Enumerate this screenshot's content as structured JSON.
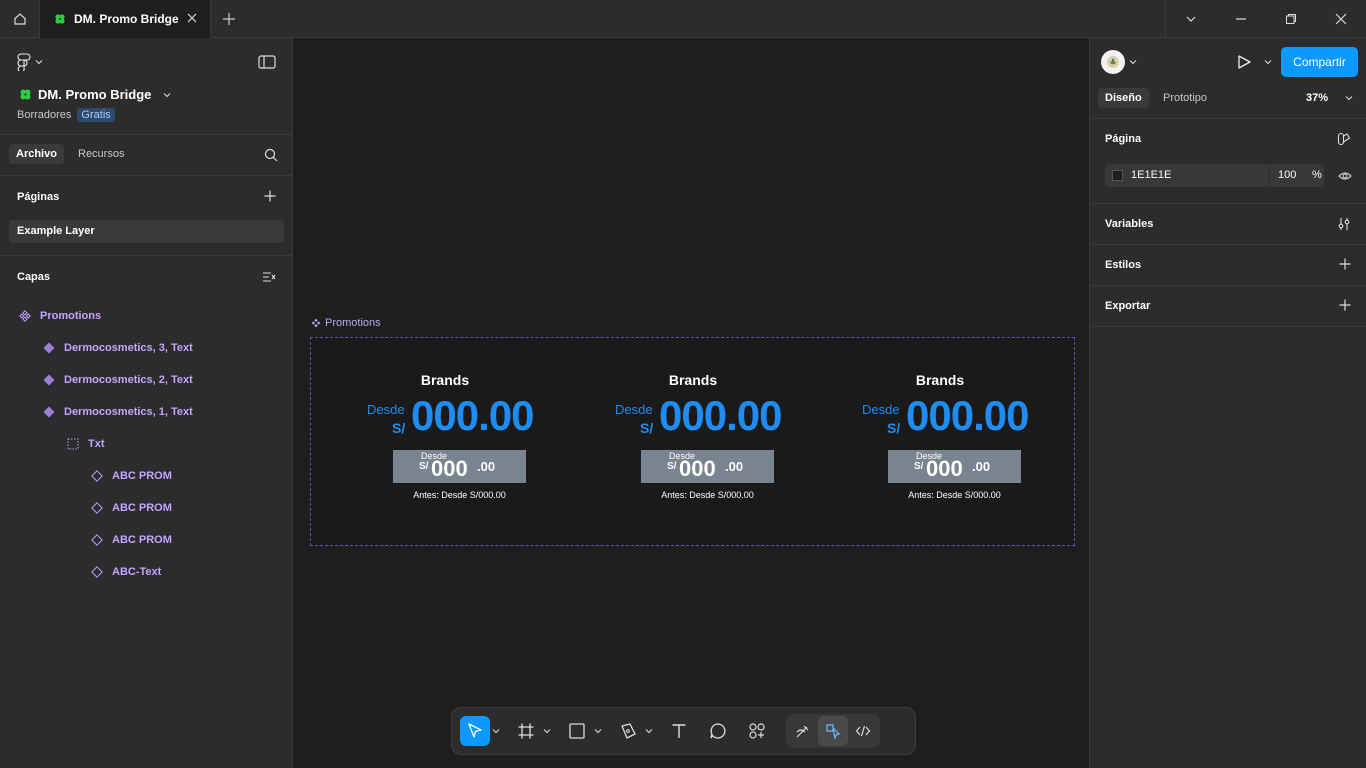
{
  "tab": {
    "title": "DM. Promo Bridge"
  },
  "file": {
    "name": "DM. Promo Bridge",
    "location": "Borradores",
    "plan_badge": "Gratis"
  },
  "left_tabs": {
    "archivo": "Archivo",
    "recursos": "Recursos"
  },
  "pages": {
    "title": "Páginas",
    "items": [
      "Example Layer"
    ]
  },
  "layers": {
    "title": "Capas",
    "items": [
      {
        "label": "Promotions",
        "icon": "component-icon"
      },
      {
        "label": "Dermocosmetics, 3, Text",
        "icon": "instance-icon"
      },
      {
        "label": "Dermocosmetics, 2, Text",
        "icon": "instance-icon"
      },
      {
        "label": "Dermocosmetics, 1, Text",
        "icon": "instance-icon"
      },
      {
        "label": "Txt",
        "icon": "frame-dashed-icon"
      },
      {
        "label": "ABC PROM",
        "icon": "instance-outline-icon"
      },
      {
        "label": "ABC PROM",
        "icon": "instance-outline-icon"
      },
      {
        "label": "ABC PROM",
        "icon": "instance-outline-icon"
      },
      {
        "label": "ABC-Text",
        "icon": "instance-outline-icon"
      }
    ]
  },
  "canvas": {
    "frame_label": "Promotions",
    "cards": [
      {
        "brand": "Brands",
        "desde": "Desde",
        "currency": "S/",
        "price": "000.00",
        "box_desde": "Desde",
        "box_currency": "S/",
        "box_price": "000",
        "box_decimal": ".00",
        "antes": "Antes: Desde S/000.00"
      },
      {
        "brand": "Brands",
        "desde": "Desde",
        "currency": "S/",
        "price": "000.00",
        "box_desde": "Desde",
        "box_currency": "S/",
        "box_price": "000",
        "box_decimal": ".00",
        "antes": "Antes: Desde S/000.00"
      },
      {
        "brand": "Brands",
        "desde": "Desde",
        "currency": "S/",
        "price": "000.00",
        "box_desde": "Desde",
        "box_currency": "S/",
        "box_price": "000",
        "box_decimal": ".00",
        "antes": "Antes: Desde S/000.00"
      }
    ]
  },
  "help": {
    "label": "?"
  },
  "right": {
    "share_label": "Compartir",
    "tab_design": "Diseño",
    "tab_prototype": "Prototipo",
    "zoom": "37%",
    "page_section": "Página",
    "page_color": "1E1E1E",
    "page_opacity": "100",
    "percent_sign": "%",
    "variables": "Variables",
    "styles": "Estilos",
    "export": "Exportar"
  },
  "colors": {
    "accent": "#0d99ff",
    "price_blue": "#1e8cf0",
    "component_purple": "#c3a5ff",
    "canvas": "#1e1e1e"
  }
}
